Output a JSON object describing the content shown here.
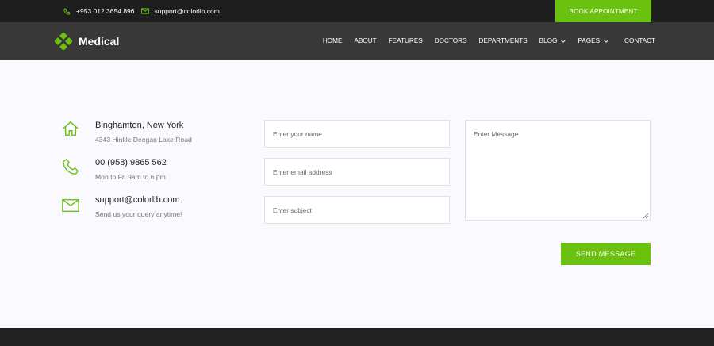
{
  "topbar": {
    "phone": "+953 012 3654 896",
    "email": "support@colorlib.com",
    "book_label": "BOOK APPOINTMENT"
  },
  "brand": {
    "name": "Medical"
  },
  "nav": {
    "items": [
      {
        "label": "HOME",
        "dropdown": false
      },
      {
        "label": "ABOUT",
        "dropdown": false
      },
      {
        "label": "FEATURES",
        "dropdown": false
      },
      {
        "label": "DOCTORS",
        "dropdown": false
      },
      {
        "label": "DEPARTMENTS",
        "dropdown": false
      },
      {
        "label": "BLOG",
        "dropdown": true
      },
      {
        "label": "PAGES",
        "dropdown": true
      },
      {
        "label": "CONTACT",
        "dropdown": false
      }
    ]
  },
  "contact_info": {
    "address": {
      "title": "Binghamton, New York",
      "sub": "4343 Hinkle Deegan Lake Road"
    },
    "phone": {
      "title": "00 (958) 9865 562",
      "sub": "Mon to Fri 9am to 6 pm"
    },
    "email": {
      "title": "support@colorlib.com",
      "sub": "Send us your query anytime!"
    }
  },
  "form": {
    "name_placeholder": "Enter your name",
    "email_placeholder": "Enter email address",
    "subject_placeholder": "Enter subject",
    "message_placeholder": "Enter Message",
    "send_label": "SEND MESSAGE"
  },
  "colors": {
    "accent": "#6bc20e",
    "topbar": "#1e1e1e",
    "navbar": "#383838",
    "footer": "#222222"
  }
}
